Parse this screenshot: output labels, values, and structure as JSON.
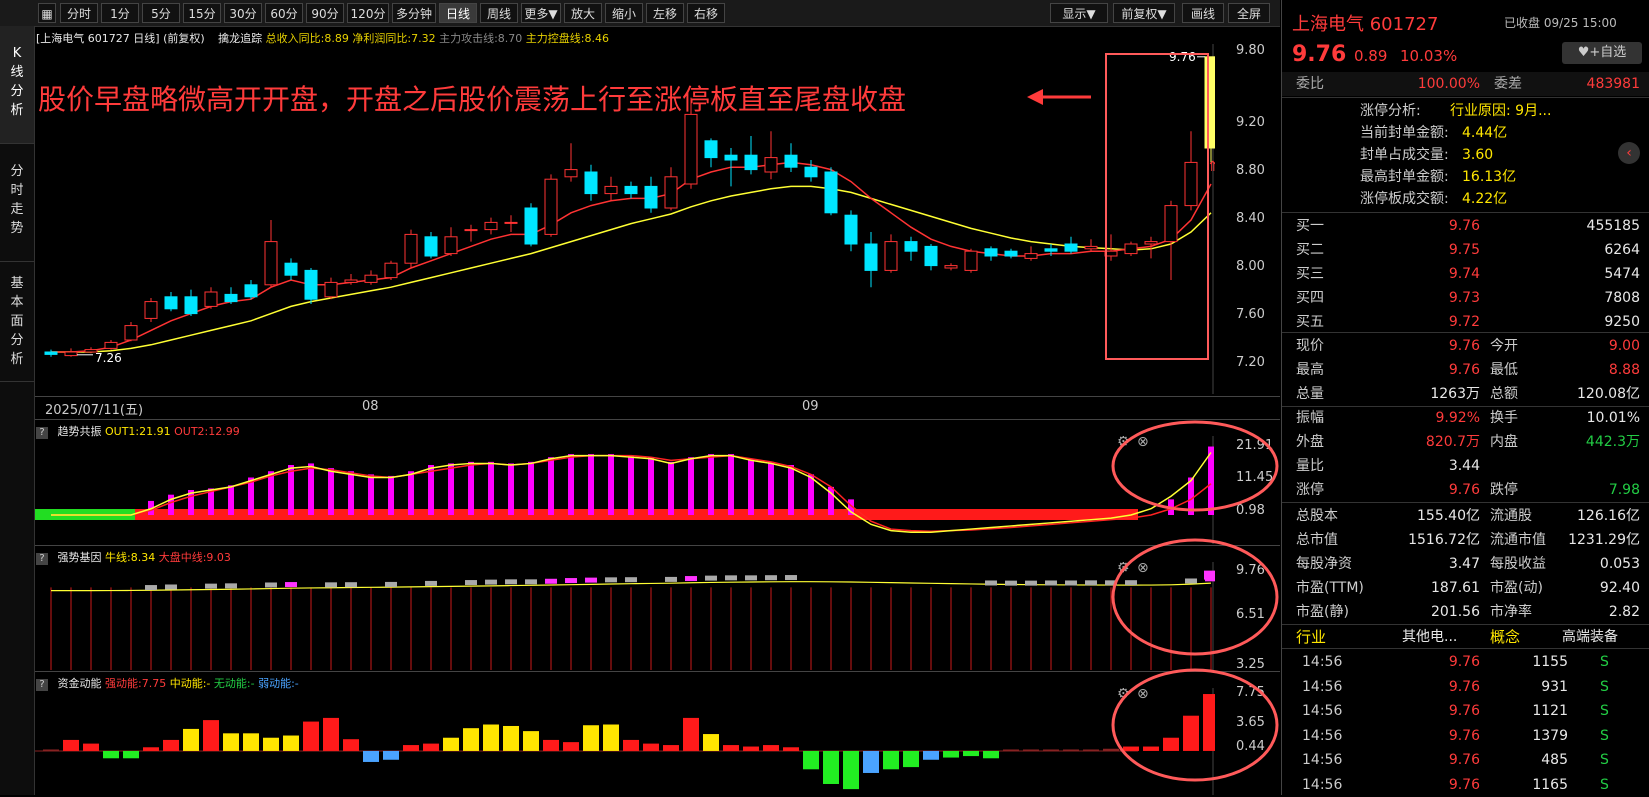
{
  "toolbar": {
    "items": [
      "分时",
      "1分",
      "5分",
      "15分",
      "30分",
      "60分",
      "90分",
      "120分",
      "多分钟",
      "日线",
      "周线",
      "更多▼",
      "放大",
      "缩小",
      "左移",
      "右移"
    ],
    "active": "日线",
    "right_items": [
      "显示▼",
      "前复权▼",
      "画线",
      "全屏"
    ]
  },
  "left_tabs": [
    {
      "label": [
        "K",
        "线",
        "分",
        "析"
      ]
    },
    {
      "label": [
        "分",
        "时",
        "走",
        "势"
      ]
    },
    {
      "label": [
        "基",
        "本",
        "面",
        "分",
        "析"
      ]
    }
  ],
  "main_chart": {
    "title": "[上海电气 601727 日线]",
    "mode": "(前复权)",
    "indicator_name": "擒龙追踪",
    "ind1": "总收入同比:8.89",
    "ind2": "净利润同比:7.32",
    "ind3": "主力攻击线:8.70",
    "ind4": "主力控盘线:8.46",
    "annotation": "股价早盘略微高开开盘，开盘之后股价震荡上行至涨停板直至尾盘收盘",
    "high_label": "9.76",
    "low_label": "7.26",
    "date_start": "2025/07/11(五)",
    "month1": "08",
    "month2": "09",
    "y_ticks": [
      "9.80",
      "9.20",
      "8.80",
      "8.40",
      "8.00",
      "7.60",
      "7.20"
    ]
  },
  "chart_data": {
    "type": "candlestick",
    "ylim": [
      7.2,
      9.8
    ],
    "candles": [
      [
        7.3,
        7.28,
        7.32,
        7.26
      ],
      [
        7.27,
        7.3,
        7.33,
        7.26
      ],
      [
        7.3,
        7.32,
        7.34,
        7.29
      ],
      [
        7.33,
        7.38,
        7.4,
        7.32
      ],
      [
        7.4,
        7.52,
        7.55,
        7.39
      ],
      [
        7.58,
        7.72,
        7.75,
        7.55
      ],
      [
        7.76,
        7.66,
        7.8,
        7.64
      ],
      [
        7.76,
        7.62,
        7.82,
        7.6
      ],
      [
        7.68,
        7.8,
        7.84,
        7.66
      ],
      [
        7.78,
        7.72,
        7.84,
        7.7
      ],
      [
        7.86,
        7.76,
        7.9,
        7.74
      ],
      [
        7.86,
        8.22,
        8.4,
        7.84
      ],
      [
        8.04,
        7.94,
        8.08,
        7.9
      ],
      [
        7.98,
        7.74,
        8.0,
        7.7
      ],
      [
        7.76,
        7.88,
        7.92,
        7.74
      ],
      [
        7.88,
        7.9,
        7.95,
        7.86
      ],
      [
        7.88,
        7.94,
        7.98,
        7.86
      ],
      [
        7.92,
        8.04,
        8.06,
        7.9
      ],
      [
        8.04,
        8.28,
        8.32,
        8.0
      ],
      [
        8.26,
        8.1,
        8.3,
        8.08
      ],
      [
        8.12,
        8.26,
        8.34,
        8.1
      ],
      [
        8.32,
        8.32,
        8.36,
        8.22
      ],
      [
        8.32,
        8.38,
        8.42,
        8.28
      ],
      [
        8.38,
        8.38,
        8.44,
        8.3
      ],
      [
        8.5,
        8.2,
        8.54,
        8.18
      ],
      [
        8.28,
        8.74,
        8.78,
        8.26
      ],
      [
        8.76,
        8.82,
        9.04,
        8.72
      ],
      [
        8.8,
        8.62,
        8.86,
        8.56
      ],
      [
        8.62,
        8.68,
        8.76,
        8.56
      ],
      [
        8.68,
        8.62,
        8.72,
        8.58
      ],
      [
        8.68,
        8.5,
        8.76,
        8.46
      ],
      [
        8.5,
        8.76,
        8.84,
        8.48
      ],
      [
        8.7,
        9.28,
        9.42,
        8.66
      ],
      [
        9.06,
        8.92,
        9.08,
        8.84
      ],
      [
        8.94,
        8.9,
        9.0,
        8.68
      ],
      [
        8.94,
        8.82,
        9.1,
        8.78
      ],
      [
        8.8,
        8.92,
        9.14,
        8.74
      ],
      [
        8.94,
        8.84,
        9.04,
        8.8
      ],
      [
        8.84,
        8.76,
        8.9,
        8.72
      ],
      [
        8.8,
        8.46,
        8.84,
        8.44
      ],
      [
        8.44,
        8.2,
        8.48,
        8.14
      ],
      [
        8.2,
        7.98,
        8.3,
        7.84
      ],
      [
        7.98,
        8.22,
        8.28,
        7.96
      ],
      [
        8.22,
        8.14,
        8.26,
        8.06
      ],
      [
        8.18,
        8.02,
        8.2,
        7.98
      ],
      [
        8.0,
        8.02,
        8.04,
        7.98
      ],
      [
        7.98,
        8.14,
        8.16,
        7.96
      ],
      [
        8.16,
        8.1,
        8.18,
        8.06
      ],
      [
        8.14,
        8.1,
        8.16,
        8.08
      ],
      [
        8.08,
        8.12,
        8.18,
        8.06
      ],
      [
        8.16,
        8.14,
        8.2,
        8.1
      ],
      [
        8.2,
        8.14,
        8.26,
        8.12
      ],
      [
        8.16,
        8.18,
        8.24,
        8.14
      ],
      [
        8.1,
        8.14,
        8.28,
        8.06
      ],
      [
        8.12,
        8.2,
        8.22,
        8.1
      ],
      [
        8.2,
        8.22,
        8.26,
        8.08
      ],
      [
        8.22,
        8.52,
        8.56,
        7.9
      ],
      [
        8.52,
        8.88,
        9.14,
        8.48
      ],
      [
        9.0,
        9.76,
        9.76,
        8.88
      ]
    ],
    "ma_red": [
      7.3,
      7.3,
      7.31,
      7.34,
      7.4,
      7.48,
      7.56,
      7.62,
      7.68,
      7.72,
      7.74,
      7.84,
      7.9,
      7.86,
      7.86,
      7.88,
      7.9,
      7.92,
      8.0,
      8.06,
      8.12,
      8.18,
      8.24,
      8.28,
      8.28,
      8.36,
      8.46,
      8.52,
      8.56,
      8.58,
      8.58,
      8.62,
      8.74,
      8.8,
      8.84,
      8.84,
      8.86,
      8.88,
      8.86,
      8.82,
      8.72,
      8.58,
      8.46,
      8.34,
      8.24,
      8.18,
      8.14,
      8.12,
      8.1,
      8.1,
      8.12,
      8.12,
      8.14,
      8.14,
      8.16,
      8.18,
      8.24,
      8.4,
      8.7
    ],
    "ma_yellow": [
      7.3,
      7.3,
      7.3,
      7.31,
      7.33,
      7.36,
      7.4,
      7.44,
      7.48,
      7.52,
      7.56,
      7.62,
      7.68,
      7.72,
      7.75,
      7.78,
      7.81,
      7.84,
      7.88,
      7.92,
      7.96,
      8.0,
      8.04,
      8.08,
      8.12,
      8.17,
      8.22,
      8.27,
      8.32,
      8.37,
      8.41,
      8.45,
      8.51,
      8.56,
      8.6,
      8.63,
      8.66,
      8.68,
      8.68,
      8.66,
      8.63,
      8.58,
      8.53,
      8.48,
      8.43,
      8.38,
      8.33,
      8.29,
      8.25,
      8.22,
      8.2,
      8.18,
      8.17,
      8.16,
      8.15,
      8.16,
      8.2,
      8.3,
      8.46
    ],
    "trend_bars": [
      0,
      0,
      0,
      0,
      0,
      4.5,
      6.5,
      8,
      8.5,
      9.5,
      12,
      14,
      16,
      16.5,
      15,
      14,
      13,
      12.5,
      14,
      16,
      16.5,
      17,
      17,
      16.5,
      17,
      18.5,
      19.5,
      19.5,
      19.5,
      19,
      18.5,
      17,
      18.5,
      19.5,
      19.5,
      18,
      17,
      16,
      13,
      9,
      5,
      0,
      0,
      0,
      0,
      0,
      0,
      0,
      0,
      0,
      0,
      0,
      0,
      0,
      0,
      0,
      5,
      12,
      21.91
    ],
    "trend_yellow": [
      0,
      0,
      0,
      0,
      0,
      2,
      5,
      7,
      8,
      9,
      11,
      13,
      15,
      15.5,
      14,
      13,
      12,
      12,
      13,
      15,
      16,
      16.5,
      16.5,
      16,
      16.5,
      18,
      19,
      19,
      19,
      18.5,
      18,
      16.5,
      18,
      19,
      19,
      17.5,
      16.5,
      15,
      12,
      7,
      1,
      -3,
      -5,
      -5.5,
      -5.5,
      -5,
      -4.5,
      -4,
      -3.5,
      -3,
      -2.5,
      -2,
      -1.5,
      -1,
      0,
      2,
      6,
      11,
      20
    ],
    "trend_red": [
      0,
      0,
      0,
      0,
      0,
      1.5,
      4,
      6,
      7.5,
      9,
      10.5,
      12.5,
      14,
      15,
      14.5,
      13.5,
      12.5,
      12,
      13,
      14,
      15,
      16,
      16.5,
      16,
      16.5,
      17.5,
      18.5,
      19,
      19,
      19,
      18.5,
      17.5,
      18,
      18.5,
      19,
      18,
      17,
      15.5,
      13,
      9,
      3,
      -2,
      -4.5,
      -5,
      -5.2,
      -5,
      -4.8,
      -4.4,
      -4,
      -3.5,
      -3,
      -2.5,
      -2,
      -1.5,
      -1,
      0,
      2,
      5,
      10
    ],
    "strong_boxes": [
      0,
      0,
      0,
      0,
      0,
      1,
      1,
      0,
      1,
      1,
      0,
      1,
      2,
      0,
      1,
      1,
      0,
      1,
      0,
      1,
      0,
      1,
      1,
      1,
      1,
      2,
      2,
      2,
      1,
      1,
      0,
      1,
      2,
      1,
      1,
      1,
      1,
      1,
      0,
      0,
      0,
      0,
      0,
      0,
      0,
      0,
      0,
      1,
      1,
      1,
      1,
      1,
      1,
      1,
      1,
      0,
      0,
      1,
      2
    ],
    "fund_bars": [
      0.2,
      1.5,
      1.0,
      -1.0,
      -1.0,
      0.5,
      1.5,
      3.0,
      4.2,
      2.4,
      2.4,
      1.8,
      2.1,
      4.0,
      4.5,
      1.6,
      -1.5,
      -1.2,
      0.8,
      1.0,
      1.8,
      3.1,
      3.6,
      3.4,
      2.7,
      1.5,
      1.2,
      3.5,
      3.6,
      1.5,
      1.0,
      0.8,
      4.5,
      2.3,
      0.8,
      0.6,
      0.8,
      0.5,
      -2.5,
      -4.5,
      -5.2,
      -3.0,
      -2.5,
      -2.2,
      -1.2,
      -0.9,
      -0.7,
      -1.0,
      0.2,
      0.2,
      0.2,
      0.2,
      0.2,
      0.3,
      0.6,
      0.6,
      1.8,
      4.8,
      7.75
    ]
  },
  "trend_panel": {
    "name": "趋势共振",
    "out1": "OUT1:21.91",
    "out2": "OUT2:12.99",
    "ticks": [
      "21.91",
      "11.45",
      "0.98"
    ]
  },
  "strong_panel": {
    "name": "强势基因",
    "l1": "牛线:8.34",
    "l2": "大盘中线:9.03",
    "ticks": [
      "9.76",
      "6.51",
      "3.25"
    ]
  },
  "fund_panel": {
    "name": "资金动能",
    "l1": "强动能:7.75",
    "l2": "中动能:-",
    "l3": "无动能:-",
    "l4": "弱动能:-",
    "ticks": [
      "7.75",
      "3.65",
      "0.44"
    ]
  },
  "stock": {
    "name": "上海电气 601727",
    "status": "已收盘 09/25 15:00",
    "price": "9.76",
    "change": "0.89",
    "pct": "10.03%",
    "watch": "+自选",
    "wb_label": "委比",
    "wb": "100.00%",
    "wc_label": "委差",
    "wc": "483981"
  },
  "limit_info": [
    {
      "k": "涨停分析:",
      "v": "行业原因: 9月..."
    },
    {
      "k": "当前封单金额:",
      "v": "4.44亿"
    },
    {
      "k": "封单占成交量:",
      "v": "3.60"
    },
    {
      "k": "最高封单金额:",
      "v": "16.13亿"
    },
    {
      "k": "涨停板成交额:",
      "v": "4.22亿"
    }
  ],
  "bids": [
    {
      "k": "买一",
      "p": "9.76",
      "v": "455185"
    },
    {
      "k": "买二",
      "p": "9.75",
      "v": "6264"
    },
    {
      "k": "买三",
      "p": "9.74",
      "v": "5474"
    },
    {
      "k": "买四",
      "p": "9.73",
      "v": "7808"
    },
    {
      "k": "买五",
      "p": "9.72",
      "v": "9250"
    }
  ],
  "quote": [
    {
      "k1": "现价",
      "v1": "9.76",
      "c1": "red",
      "k2": "今开",
      "v2": "9.00",
      "c2": "red"
    },
    {
      "k1": "最高",
      "v1": "9.76",
      "c1": "red",
      "k2": "最低",
      "v2": "8.88",
      "c2": "red"
    },
    {
      "k1": "总量",
      "v1": "1263万",
      "c1": "wht",
      "k2": "总额",
      "v2": "120.08亿",
      "c2": "wht"
    },
    {
      "k1": "振幅",
      "v1": "9.92%",
      "c1": "red",
      "k2": "换手",
      "v2": "10.01%",
      "c2": "wht"
    },
    {
      "k1": "外盘",
      "v1": "820.7万",
      "c1": "red",
      "k2": "内盘",
      "v2": "442.3万",
      "c2": "grn"
    },
    {
      "k1": "量比",
      "v1": "3.44",
      "c1": "wht",
      "k2": "",
      "v2": "",
      "c2": "wht"
    },
    {
      "k1": "涨停",
      "v1": "9.76",
      "c1": "red",
      "k2": "跌停",
      "v2": "7.98",
      "c2": "grn"
    }
  ],
  "fundamentals": [
    {
      "k1": "总股本",
      "v1": "155.40亿",
      "k2": "流通股",
      "v2": "126.16亿"
    },
    {
      "k1": "总市值",
      "v1": "1516.72亿",
      "k2": "流通市值",
      "v2": "1231.29亿"
    },
    {
      "k1": "每股净资",
      "v1": "3.47",
      "k2": "每股收益",
      "v2": "0.053"
    },
    {
      "k1": "市盈(TTM)",
      "v1": "187.61",
      "k2": "市盈(动)",
      "v2": "92.40"
    },
    {
      "k1": "市盈(静)",
      "v1": "201.56",
      "k2": "市净率",
      "v2": "2.82"
    }
  ],
  "industry": {
    "k1": "行业",
    "v1": "其他电...",
    "k2": "概念",
    "v2": "高端装备"
  },
  "ticks": [
    {
      "t": "14:56",
      "p": "9.76",
      "v": "1155",
      "s": "S"
    },
    {
      "t": "14:56",
      "p": "9.76",
      "v": "931",
      "s": "S"
    },
    {
      "t": "14:56",
      "p": "9.76",
      "v": "1121",
      "s": "S"
    },
    {
      "t": "14:56",
      "p": "9.76",
      "v": "1379",
      "s": "S"
    },
    {
      "t": "14:56",
      "p": "9.76",
      "v": "485",
      "s": "S"
    },
    {
      "t": "14:56",
      "p": "9.76",
      "v": "1165",
      "s": "S"
    }
  ]
}
